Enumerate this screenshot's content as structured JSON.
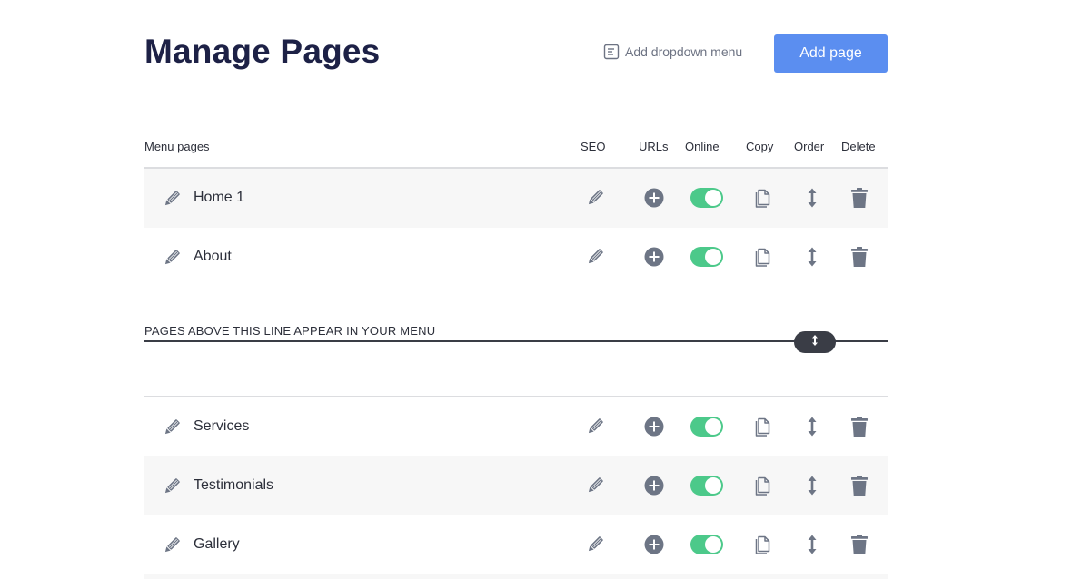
{
  "header": {
    "title": "Manage Pages",
    "dropdown_label": "Add dropdown menu",
    "add_page_label": "Add page"
  },
  "columns": {
    "menu_pages": "Menu pages",
    "seo": "SEO",
    "urls": "URLs",
    "online": "Online",
    "copy": "Copy",
    "order": "Order",
    "delete": "Delete"
  },
  "menu_pages": [
    {
      "name": "Home 1",
      "online": true
    },
    {
      "name": "About",
      "online": true
    }
  ],
  "menu_line_text": "PAGES ABOVE THIS LINE APPEAR IN YOUR MENU",
  "other_pages": [
    {
      "name": "Services",
      "online": true
    },
    {
      "name": "Testimonials",
      "online": true
    },
    {
      "name": "Gallery",
      "online": true
    }
  ],
  "colors": {
    "accent": "#5b8ef0",
    "toggle_on": "#4cc98a",
    "icon": "#6d7585",
    "title": "#1d2146"
  },
  "icons": {
    "dropdown": "menu-list-icon",
    "edit": "pencil-icon",
    "seo": "pencil-icon",
    "urls": "plus-circle-icon",
    "copy": "copy-icon",
    "order": "up-down-arrow-icon",
    "delete": "trash-icon"
  }
}
